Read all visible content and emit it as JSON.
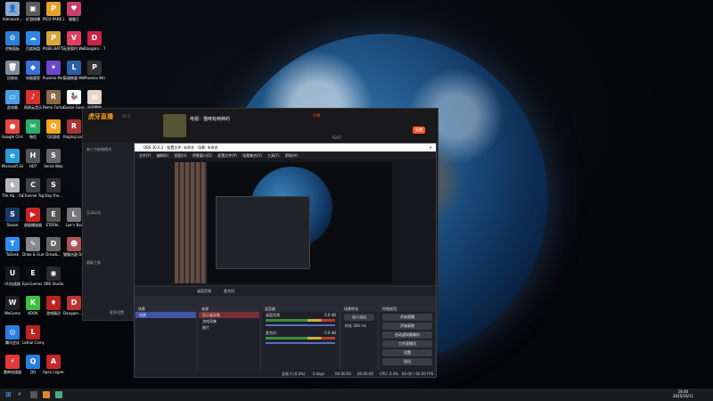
{
  "desktop": {
    "icons": [
      {
        "label": "Administr...",
        "color": "#8fa7c8",
        "sym": "👤",
        "col": 0,
        "row": 0
      },
      {
        "label": "控制面板",
        "color": "#2d7fd3",
        "sym": "⚙",
        "col": 0,
        "row": 1
      },
      {
        "label": "回收站",
        "color": "#7d8a96",
        "sym": "🗑",
        "col": 0,
        "row": 2
      },
      {
        "label": "此电脑",
        "color": "#4aa0e8",
        "sym": "▭",
        "col": 0,
        "row": 3
      },
      {
        "label": "Google Chrome",
        "color": "#e8473d",
        "sym": "●",
        "col": 0,
        "row": 4
      },
      {
        "label": "Microsoft Edge",
        "color": "#2a9ad9",
        "sym": "e",
        "col": 0,
        "row": 5
      },
      {
        "label": "The Ab... Rabbit Me...",
        "color": "#b5b5b5",
        "sym": "♞",
        "col": 0,
        "row": 6
      },
      {
        "label": "Steam",
        "color": "#1a3a66",
        "sym": "S",
        "col": 0,
        "row": 7
      },
      {
        "label": "ToDesk",
        "color": "#2d8cf0",
        "sym": "T",
        "col": 0,
        "row": 8
      },
      {
        "label": "UU加速器",
        "color": "#1a1a1a",
        "sym": "U",
        "col": 0,
        "row": 9
      },
      {
        "label": "WeGame",
        "color": "#222",
        "sym": "W",
        "col": 0,
        "row": 10
      },
      {
        "label": "腾讯会议",
        "color": "#2a7de1",
        "sym": "◎",
        "col": 0,
        "row": 11
      },
      {
        "label": "雷神加速器",
        "color": "#e03a3a",
        "sym": "⚡",
        "col": 0,
        "row": 12
      },
      {
        "label": "好游快爆",
        "color": "#5b5b5b",
        "sym": "▣",
        "col": 1,
        "row": 0
      },
      {
        "label": "百度网盘",
        "color": "#2d87e6",
        "sym": "☁",
        "col": 1,
        "row": 1
      },
      {
        "label": "电脑管家",
        "color": "#3a6fd8",
        "sym": "◆",
        "col": 1,
        "row": 2
      },
      {
        "label": "网易云音乐",
        "color": "#d6322e",
        "sym": "♪",
        "col": 1,
        "row": 3
      },
      {
        "label": "微信",
        "color": "#2aae67",
        "sym": "✉",
        "col": 1,
        "row": 4
      },
      {
        "label": "HDT",
        "color": "#555",
        "sym": "H",
        "col": 1,
        "row": 5
      },
      {
        "label": "Channel Together",
        "color": "#444",
        "sym": "C",
        "col": 1,
        "row": 6
      },
      {
        "label": "超级播放器",
        "color": "#c22",
        "sym": "▶",
        "col": 1,
        "row": 7
      },
      {
        "label": "Draw & Guess",
        "color": "#888",
        "sym": "✎",
        "col": 1,
        "row": 8
      },
      {
        "label": "EpicGames Launcher",
        "color": "#111",
        "sym": "E",
        "col": 1,
        "row": 9
      },
      {
        "label": "KOOK",
        "color": "#3fbf3f",
        "sym": "K",
        "col": 1,
        "row": 10
      },
      {
        "label": "Lethal Company",
        "color": "#b22",
        "sym": "L",
        "col": 1,
        "row": 11
      },
      {
        "label": "QQ",
        "color": "#2a7de1",
        "sym": "Q",
        "col": 1,
        "row": 12
      },
      {
        "label": "PICO PARK 2",
        "color": "#e4a12c",
        "sym": "P",
        "col": 2,
        "row": 0
      },
      {
        "label": "PUBG BATTLEGR...",
        "color": "#d8a63b",
        "sym": "P",
        "col": 2,
        "row": 1
      },
      {
        "label": "Puzzmo Party",
        "color": "#6a48c8",
        "sym": "✦",
        "col": 2,
        "row": 2
      },
      {
        "label": "Remo Fortune",
        "color": "#8a6a4a",
        "sym": "R",
        "col": 2,
        "row": 3
      },
      {
        "label": "QQ游戏",
        "color": "#f6a623",
        "sym": "Q",
        "col": 2,
        "row": 4
      },
      {
        "label": "Serial Wep",
        "color": "#666",
        "sym": "S",
        "col": 2,
        "row": 5
      },
      {
        "label": "Slay the...",
        "color": "#333",
        "sym": "S",
        "col": 2,
        "row": 6
      },
      {
        "label": "ETERN...",
        "color": "#555",
        "sym": "E",
        "col": 2,
        "row": 7
      },
      {
        "label": "Draw&...",
        "color": "#666",
        "sym": "D",
        "col": 2,
        "row": 8
      },
      {
        "label": "OBS Studio",
        "color": "#2b2b2b",
        "sym": "◉",
        "col": 2,
        "row": 9
      },
      {
        "label": "游戏精灵",
        "color": "#b22",
        "sym": "♦",
        "col": 2,
        "row": 10
      },
      {
        "label": "Apex Legends",
        "color": "#c62828",
        "sym": "A",
        "col": 2,
        "row": 12
      },
      {
        "label": "猫猫王",
        "color": "#c73e6b",
        "sym": "♥",
        "col": 3,
        "row": 0
      },
      {
        "label": "无畏契约 WeGame版",
        "color": "#e04060",
        "sym": "V",
        "col": 3,
        "row": 1
      },
      {
        "label": "英雄联盟 WeGame版",
        "color": "#2b5fa8",
        "sym": "L",
        "col": 3,
        "row": 2
      },
      {
        "label": "Goose Goose Duck",
        "color": "#fff",
        "sym": "🦆",
        "col": 3,
        "row": 3
      },
      {
        "label": "Raging Loop",
        "color": "#a33",
        "sym": "R",
        "col": 3,
        "row": 4
      },
      {
        "label": "Danganr... Trigger H...",
        "color": "#c24",
        "sym": "D",
        "col": 4,
        "row": 1
      },
      {
        "label": "Phoenix Wright A...",
        "color": "#333",
        "sym": "P",
        "col": 4,
        "row": 2
      },
      {
        "label": "桌面翻转",
        "color": "#e4d6c8",
        "sym": "▤",
        "col": 4,
        "row": 3
      },
      {
        "label": "金秋",
        "color": "#c69c3a",
        "sym": "★",
        "col": 4,
        "row": 5
      },
      {
        "label": "Liar's Bar",
        "color": "#777",
        "sym": "L",
        "col": 3,
        "row": 7
      },
      {
        "label": "猫猫击鼓 Demo",
        "color": "#a55",
        "sym": "☻",
        "col": 3,
        "row": 8
      },
      {
        "label": "Dangam... 2 Goodb...",
        "color": "#b33",
        "sym": "D",
        "col": 3,
        "row": 10
      }
    ]
  },
  "huya": {
    "logo": "虎牙直播",
    "version": "V5.5",
    "anchor_title": "电视：猫咪有两种的",
    "side_items": [
      "新三方抽唱模式",
      "互动玩法",
      "超级工具",
      "更多设置"
    ],
    "level": "6247",
    "top_btn": "开播",
    "live_btn": "直播"
  },
  "obs": {
    "title": "OBS 30.0.2 - 配置文件: 未命名 - 场景: 未命名",
    "menu": [
      "文件(F)",
      "编辑(E)",
      "视图(V)",
      "停靠窗口(D)",
      "配置文件(P)",
      "场景集合(S)",
      "工具(T)",
      "帮助(H)"
    ],
    "tab_bar": [
      "桌面音频",
      "麦克风"
    ],
    "scene_header": "场景",
    "scene_item": "场景",
    "source_header": "来源",
    "sources": [
      "显示器采集",
      "游戏采集",
      "图片"
    ],
    "mixer_header": "混音器",
    "mixer_items": [
      {
        "name": "桌面音频",
        "db": "0.0 dB"
      },
      {
        "name": "麦克风",
        "db": "0.0 dB"
      }
    ],
    "transition_header": "场景转场",
    "transition_value": "淡入淡出",
    "transition_duration": "300 ms",
    "transition_duration_label": "时长",
    "controls_header": "控制按钮",
    "controls": [
      "开始直播",
      "开始录制",
      "启动虚拟摄像机",
      "工作室模式",
      "设置",
      "退出"
    ],
    "status": {
      "frames": "丢帧 0 (0.0%)",
      "rec": "00:00:00",
      "live": "00:00:00",
      "cpu": "CPU: 0.4%",
      "fps": "60.00 / 60.00 FPS",
      "kb": "0 kbps"
    }
  },
  "taskbar": {
    "time": "16:40",
    "date": "2025/10/11"
  }
}
